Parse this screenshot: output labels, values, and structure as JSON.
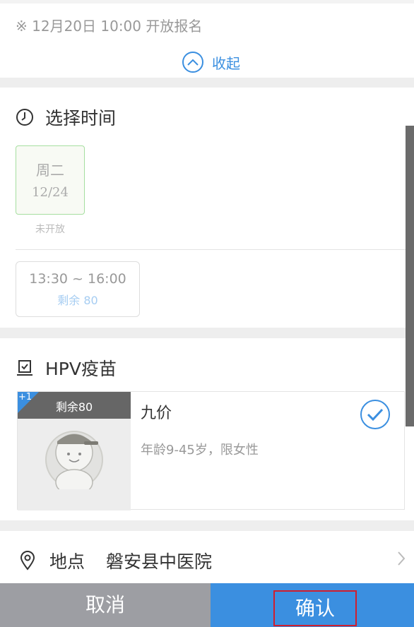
{
  "notice": {
    "text": "※ 12月20日 10:00 开放报名",
    "collapse_label": "收起"
  },
  "time_section": {
    "title": "选择时间",
    "day": {
      "weekday": "周二",
      "date": "12/24",
      "status": "未开放"
    },
    "slot": {
      "time": "13:30 ~ 16:00",
      "remaining": "剩余 80"
    }
  },
  "vaccine_section": {
    "title": "HPV疫苗",
    "item": {
      "badge": "+1",
      "remaining": "剩余80",
      "name": "九价",
      "description": "年龄9-45岁，限女性",
      "selected": true
    }
  },
  "location": {
    "label": "地点",
    "value": "磐安县中医院"
  },
  "footer": {
    "cancel_label": "取消",
    "confirm_label": "确认"
  },
  "colors": {
    "accent": "#3b8fe0",
    "cancel_bg": "#9d9ea3",
    "highlight_border": "#d01e2e",
    "day_border": "#a6dfa0"
  }
}
